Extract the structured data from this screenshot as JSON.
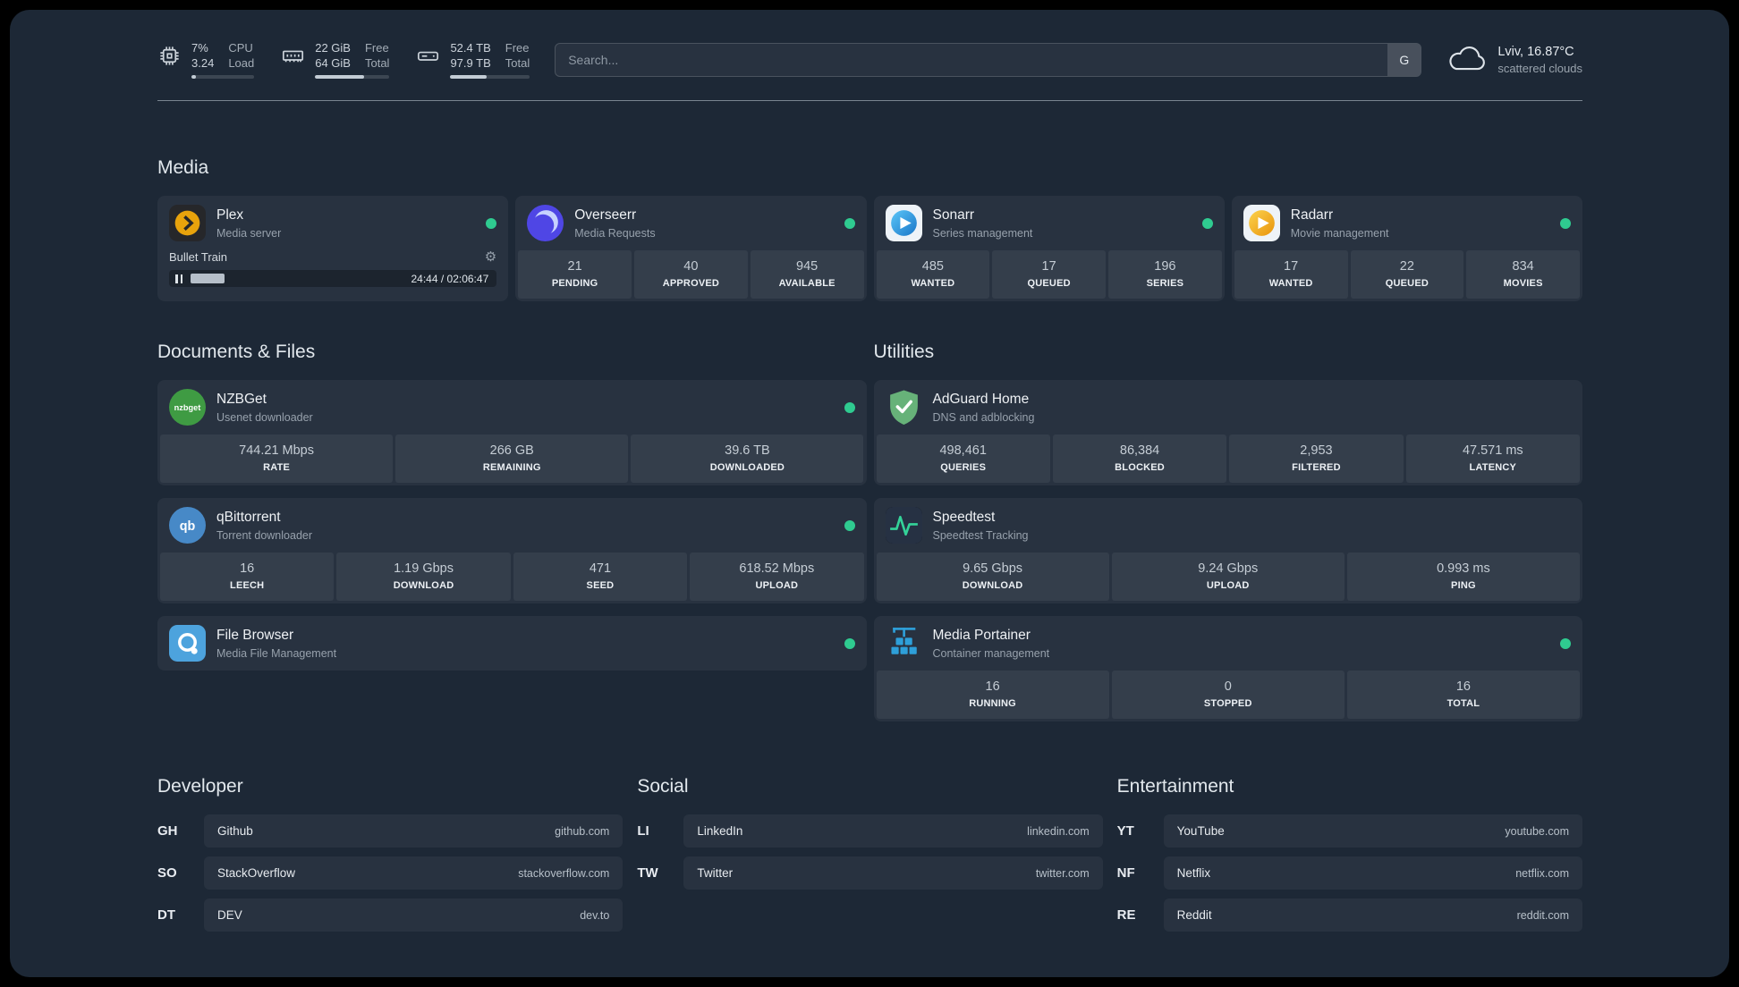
{
  "topbar": {
    "resources": [
      {
        "icon": "cpu-icon",
        "value1": "7%",
        "label1": "CPU",
        "value2": "3.24",
        "label2": "Load",
        "progress": 7
      },
      {
        "icon": "memory-icon",
        "value1": "22 GiB",
        "label1": "Free",
        "value2": "64 GiB",
        "label2": "Total",
        "progress": 66
      },
      {
        "icon": "disk-icon",
        "value1": "52.4 TB",
        "label1": "Free",
        "value2": "97.9 TB",
        "label2": "Total",
        "progress": 46
      }
    ],
    "search": {
      "placeholder": "Search...",
      "provider_button": "G"
    },
    "weather": {
      "icon": "cloud-icon",
      "location": "Lviv, 16.87°C",
      "condition": "scattered clouds"
    }
  },
  "sections": {
    "media": {
      "title": "Media",
      "cards": [
        {
          "name": "Plex",
          "description": "Media server",
          "icon": "plex-icon",
          "status": "online",
          "player": {
            "title": "Bullet Train",
            "time": "24:44 / 02:06:47",
            "progress": 16
          }
        },
        {
          "name": "Overseerr",
          "description": "Media Requests",
          "icon": "overseerr-icon",
          "status": "online",
          "stats": [
            {
              "value": "21",
              "label": "PENDING"
            },
            {
              "value": "40",
              "label": "APPROVED"
            },
            {
              "value": "945",
              "label": "AVAILABLE"
            }
          ]
        },
        {
          "name": "Sonarr",
          "description": "Series management",
          "icon": "sonarr-icon",
          "status": "online",
          "stats": [
            {
              "value": "485",
              "label": "WANTED"
            },
            {
              "value": "17",
              "label": "QUEUED"
            },
            {
              "value": "196",
              "label": "SERIES"
            }
          ]
        },
        {
          "name": "Radarr",
          "description": "Movie management",
          "icon": "radarr-icon",
          "status": "online",
          "stats": [
            {
              "value": "17",
              "label": "WANTED"
            },
            {
              "value": "22",
              "label": "QUEUED"
            },
            {
              "value": "834",
              "label": "MOVIES"
            }
          ]
        }
      ]
    },
    "documents": {
      "title": "Documents & Files",
      "cards": [
        {
          "name": "NZBGet",
          "description": "Usenet downloader",
          "icon": "nzbget-icon",
          "status": "online",
          "stats": [
            {
              "value": "744.21 Mbps",
              "label": "RATE"
            },
            {
              "value": "266 GB",
              "label": "REMAINING"
            },
            {
              "value": "39.6 TB",
              "label": "DOWNLOADED"
            }
          ]
        },
        {
          "name": "qBittorrent",
          "description": "Torrent downloader",
          "icon": "qbittorrent-icon",
          "status": "online",
          "stats": [
            {
              "value": "16",
              "label": "LEECH"
            },
            {
              "value": "1.19 Gbps",
              "label": "DOWNLOAD"
            },
            {
              "value": "471",
              "label": "SEED"
            },
            {
              "value": "618.52 Mbps",
              "label": "UPLOAD"
            }
          ]
        },
        {
          "name": "File Browser",
          "description": "Media File Management",
          "icon": "filebrowser-icon",
          "status": "online"
        }
      ]
    },
    "utilities": {
      "title": "Utilities",
      "cards": [
        {
          "name": "AdGuard Home",
          "description": "DNS and adblocking",
          "icon": "adguard-icon",
          "stats": [
            {
              "value": "498,461",
              "label": "QUERIES"
            },
            {
              "value": "86,384",
              "label": "BLOCKED"
            },
            {
              "value": "2,953",
              "label": "FILTERED"
            },
            {
              "value": "47.571 ms",
              "label": "LATENCY"
            }
          ]
        },
        {
          "name": "Speedtest",
          "description": "Speedtest Tracking",
          "icon": "speedtest-icon",
          "stats": [
            {
              "value": "9.65 Gbps",
              "label": "DOWNLOAD"
            },
            {
              "value": "9.24 Gbps",
              "label": "UPLOAD"
            },
            {
              "value": "0.993 ms",
              "label": "PING"
            }
          ]
        },
        {
          "name": "Media Portainer",
          "description": "Container management",
          "icon": "portainer-icon",
          "status": "online",
          "stats": [
            {
              "value": "16",
              "label": "RUNNING"
            },
            {
              "value": "0",
              "label": "STOPPED"
            },
            {
              "value": "16",
              "label": "TOTAL"
            }
          ]
        }
      ]
    },
    "bookmarks": {
      "groups": [
        {
          "title": "Developer",
          "items": [
            {
              "abbr": "GH",
              "name": "Github",
              "domain": "github.com"
            },
            {
              "abbr": "SO",
              "name": "StackOverflow",
              "domain": "stackoverflow.com"
            },
            {
              "abbr": "DT",
              "name": "DEV",
              "domain": "dev.to"
            }
          ]
        },
        {
          "title": "Social",
          "items": [
            {
              "abbr": "LI",
              "name": "LinkedIn",
              "domain": "linkedin.com"
            },
            {
              "abbr": "TW",
              "name": "Twitter",
              "domain": "twitter.com"
            }
          ]
        },
        {
          "title": "Entertainment",
          "items": [
            {
              "abbr": "YT",
              "name": "YouTube",
              "domain": "youtube.com"
            },
            {
              "abbr": "NF",
              "name": "Netflix",
              "domain": "netflix.com"
            },
            {
              "abbr": "RE",
              "name": "Reddit",
              "domain": "reddit.com"
            }
          ]
        }
      ]
    }
  },
  "colors": {
    "background": "#1d2836",
    "status_online": "#2fcb90",
    "bar_fill": "#c3ccd5"
  }
}
